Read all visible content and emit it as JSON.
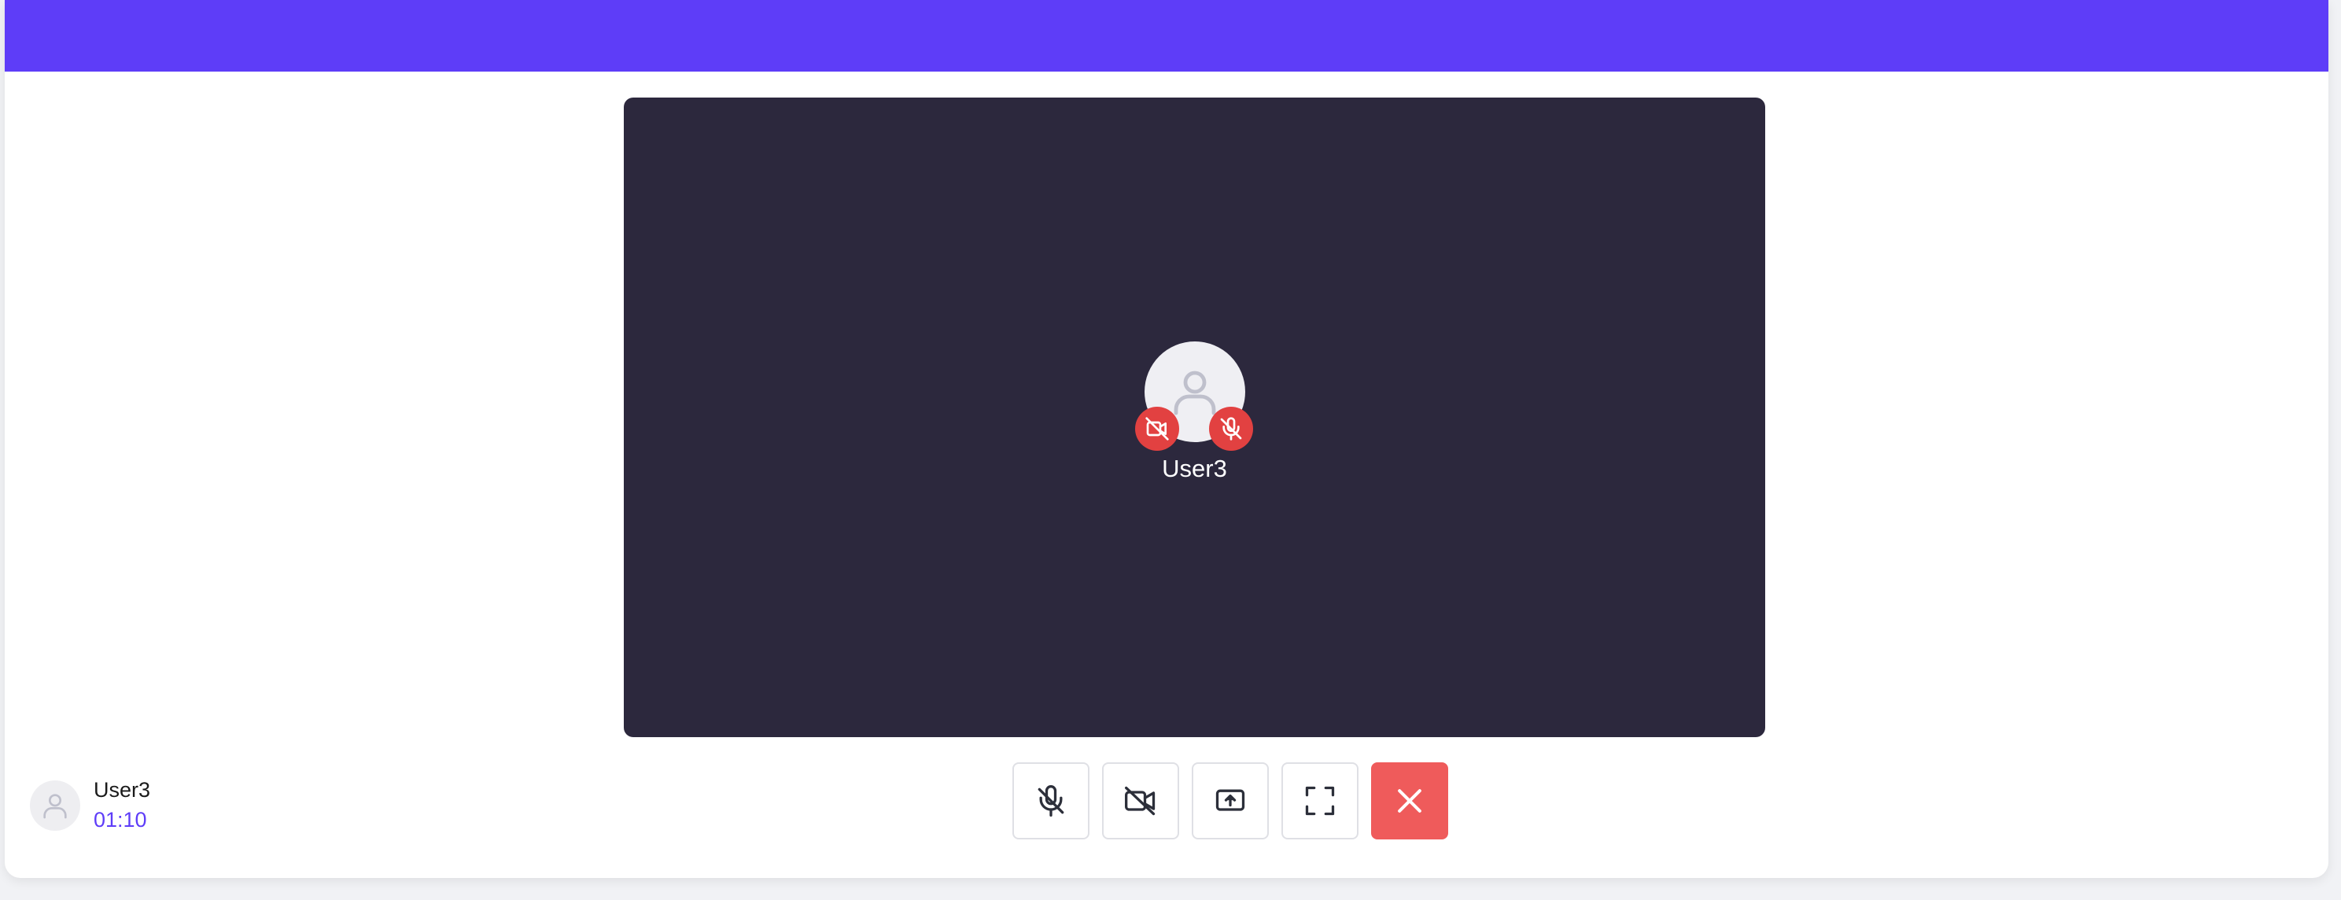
{
  "stage": {
    "participant_name": "User3",
    "avatar_icon": "user-icon",
    "camera_status_icon": "video-off-icon",
    "mic_status_icon": "mic-off-icon"
  },
  "current_user": {
    "name": "User3",
    "timer": "01:10",
    "avatar_icon": "user-icon"
  },
  "controls": [
    {
      "name": "mute-mic-button",
      "icon": "mic-off-icon"
    },
    {
      "name": "toggle-camera-button",
      "icon": "video-off-icon"
    },
    {
      "name": "share-screen-button",
      "icon": "screen-share-icon"
    },
    {
      "name": "fullscreen-button",
      "icon": "fullscreen-icon"
    },
    {
      "name": "end-call-button",
      "icon": "close-icon"
    }
  ],
  "colors": {
    "brand": "#5e3df8",
    "stage_background": "#2c283d",
    "status_off": "#e24141",
    "end_call": "#ef5b5b"
  }
}
